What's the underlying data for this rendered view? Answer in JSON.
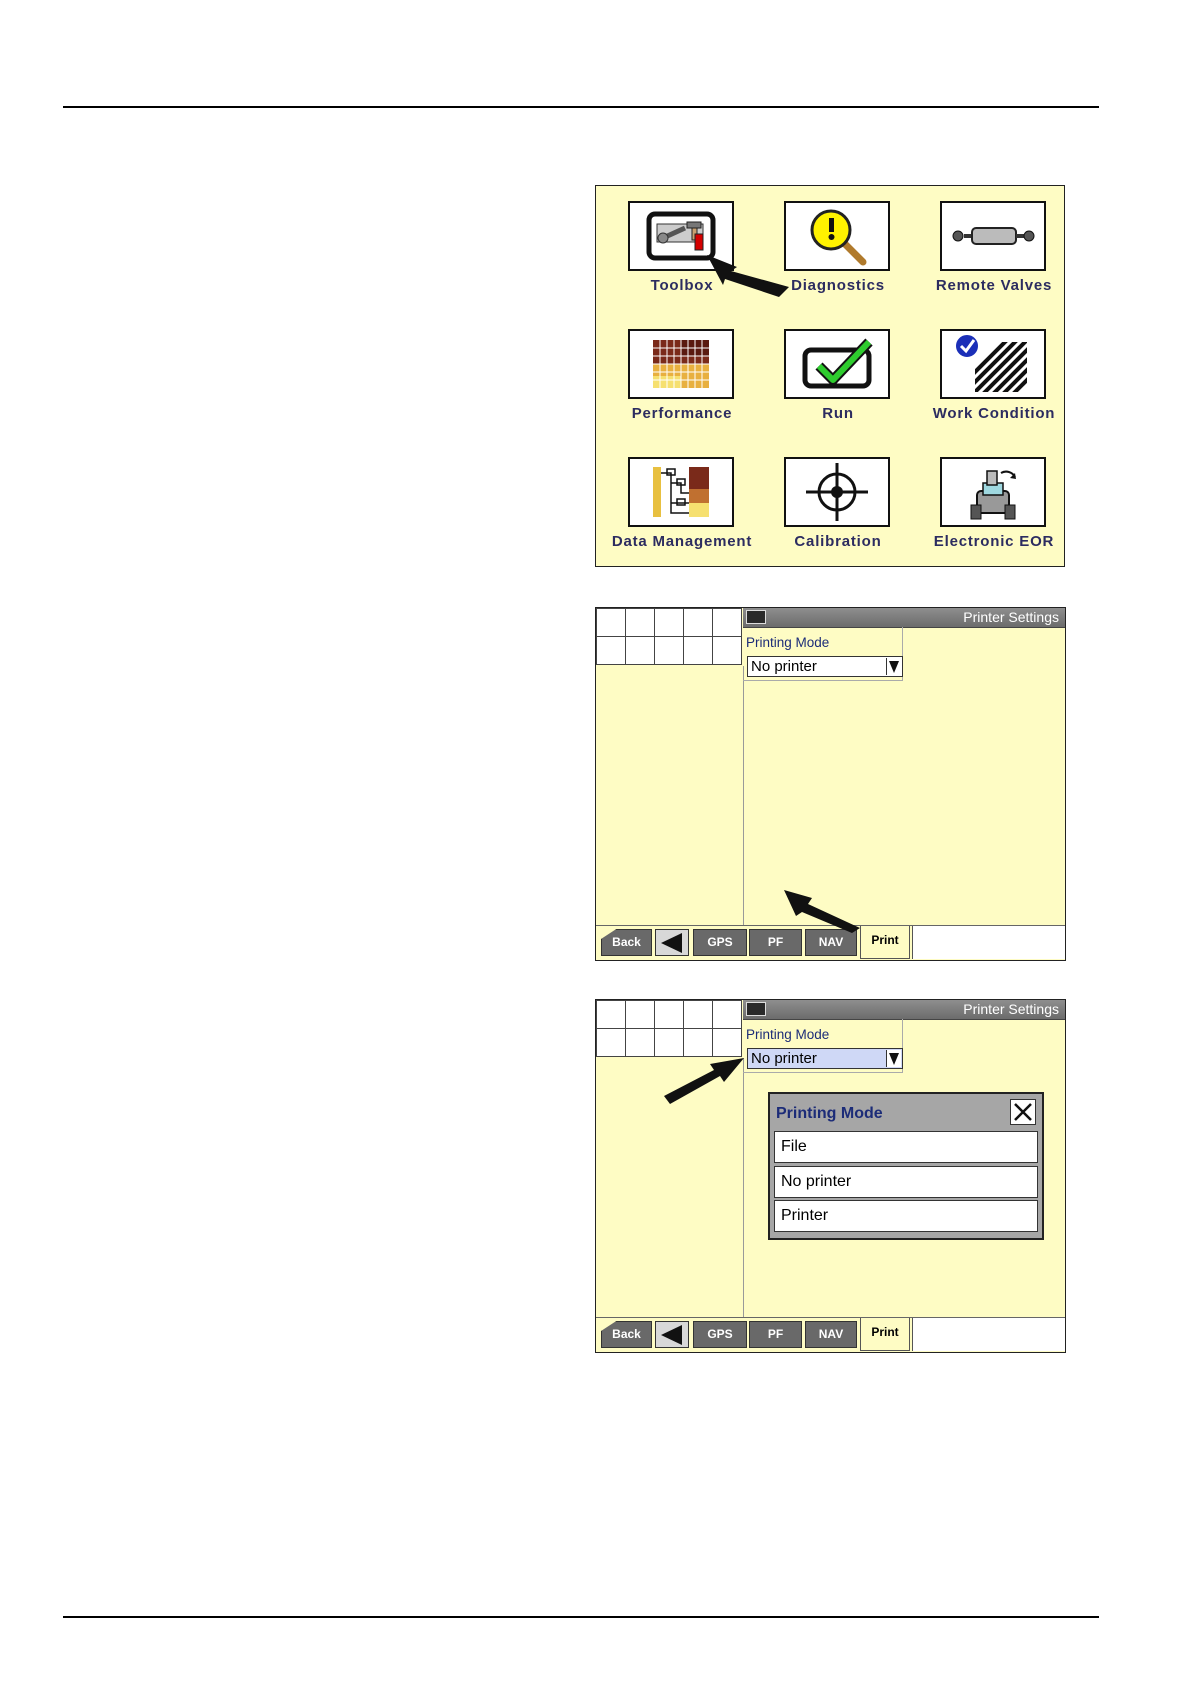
{
  "main_menu": {
    "items": [
      {
        "label": "Toolbox",
        "icon": "toolbox-icon"
      },
      {
        "label": "Diagnostics",
        "icon": "diagnostics-icon"
      },
      {
        "label": "Remote Valves",
        "icon": "remote-valves-icon"
      },
      {
        "label": "Performance",
        "icon": "performance-icon"
      },
      {
        "label": "Run",
        "icon": "run-checkmark-icon"
      },
      {
        "label": "Work Condition",
        "icon": "work-condition-icon"
      },
      {
        "label": "Data Management",
        "icon": "data-management-icon"
      },
      {
        "label": "Calibration",
        "icon": "calibration-crosshair-icon"
      },
      {
        "label": "Electronic EOR",
        "icon": "electronic-eor-icon"
      }
    ]
  },
  "printer_screen": {
    "title": "Printer Settings",
    "field_label": "Printing Mode",
    "field_value": "No printer",
    "toolbar": {
      "back": "Back",
      "gps": "GPS",
      "pf": "PF",
      "nav": "NAV",
      "print_tab": "Print"
    }
  },
  "printing_mode_dialog": {
    "title": "Printing Mode",
    "options": [
      "File",
      "No printer",
      "Printer"
    ]
  },
  "colors": {
    "screen_background": "#fefcc4",
    "label_text": "#2c2c60",
    "field_label_text": "#1c2c78",
    "toolbar_button": "#696969",
    "selected_field": "#cfd8f6"
  }
}
